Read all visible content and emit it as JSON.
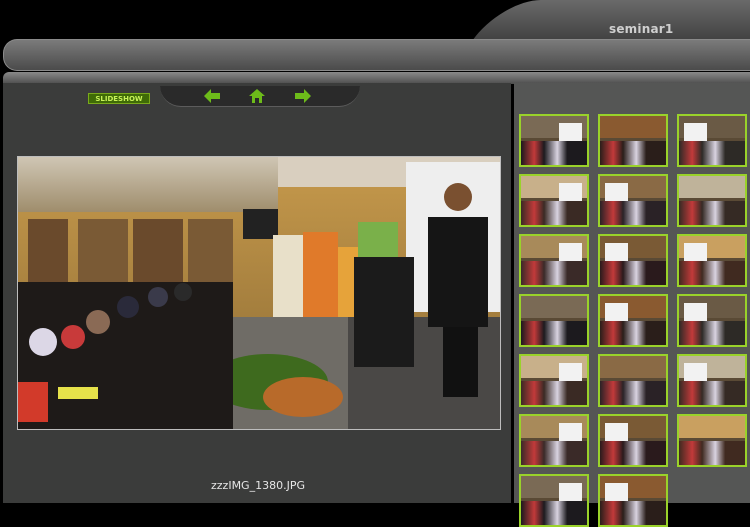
{
  "gallery": {
    "title": "seminar1"
  },
  "navigation": {
    "slideshow_label": "SLIDESHOW",
    "prev_icon": "arrow-left-icon",
    "home_icon": "home-icon",
    "next_icon": "arrow-right-icon",
    "accent_color": "#6dbb1a"
  },
  "main_image": {
    "filename": "zzzIMG_1380.JPG"
  },
  "colors": {
    "thumb_border": "#9ad22a",
    "background": "#000000"
  }
}
